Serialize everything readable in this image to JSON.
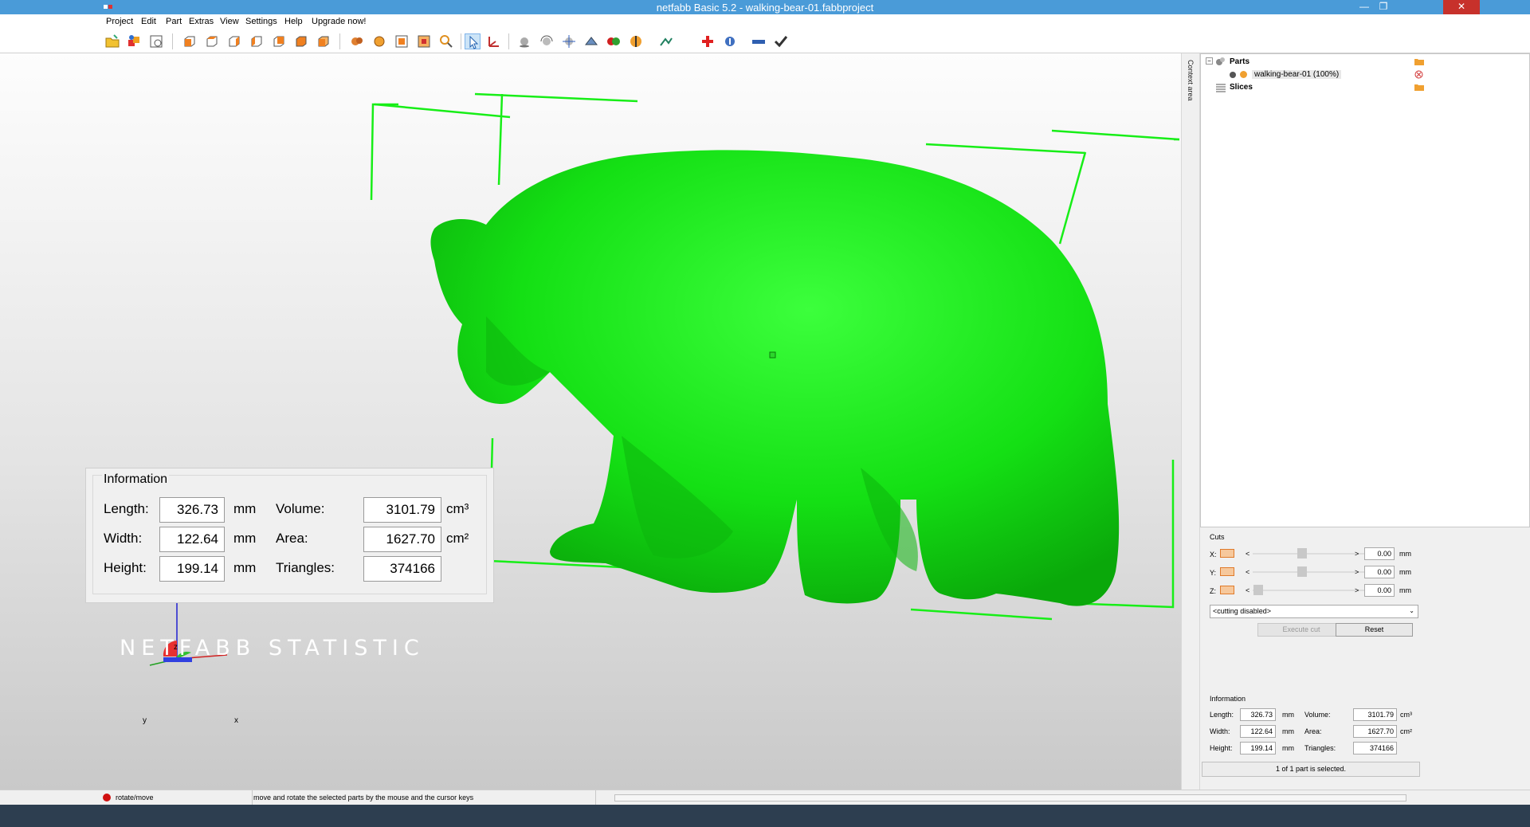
{
  "window": {
    "title": "netfabb Basic 5.2 - walking-bear-01.fabbproject"
  },
  "menu": [
    "Project",
    "Edit",
    "Part",
    "Extras",
    "View",
    "Settings",
    "Help",
    "Upgrade now!"
  ],
  "colors": {
    "titlebar": "#4a9bd8",
    "model": "#1ee81e",
    "bbox": "#17ee17",
    "close": "#c7312b",
    "taskbar": "#2d3e50"
  },
  "toolbar_icons": [
    "open-project-icon",
    "add-part-icon",
    "save-icon",
    "view-front-icon",
    "view-back-icon",
    "view-left-icon",
    "view-right-icon",
    "view-top-icon",
    "view-bottom-icon",
    "view-perspective-icon",
    "shading-icon",
    "mesh-icon",
    "zoom-all-icon",
    "zoom-selection-icon",
    "zoom-icon",
    "select-arrow-icon",
    "move-axes-icon",
    "sphere-icon",
    "rotate-icon",
    "scale-icon",
    "mirror-icon",
    "color-icon",
    "section-icon",
    "measure-icon",
    "repair-cross-icon",
    "analysis-icon",
    "ruler-icon",
    "check-icon"
  ],
  "viewport": {
    "info": {
      "title": "Information",
      "length_label": "Length:",
      "length": "326.73",
      "length_unit": "mm",
      "width_label": "Width:",
      "width": "122.64",
      "width_unit": "mm",
      "height_label": "Height:",
      "height": "199.14",
      "height_unit": "mm",
      "volume_label": "Volume:",
      "volume": "3101.79",
      "volume_unit": "cm³",
      "area_label": "Area:",
      "area": "1627.70",
      "area_unit": "cm²",
      "triangles_label": "Triangles:",
      "triangles": "374166"
    },
    "watermark": "NETFABB STATISTIC",
    "axes": {
      "x": "x",
      "y": "y",
      "z": "z"
    }
  },
  "side_tab": "Context area",
  "tree": {
    "parts_label": "Parts",
    "part_name": "walking-bear-01 (100%)",
    "slices_label": "Slices"
  },
  "cuts": {
    "title": "Cuts",
    "x_label": "X:",
    "y_label": "Y:",
    "z_label": "Z:",
    "lt": "<",
    "gt": ">",
    "x_value": "0.00",
    "y_value": "0.00",
    "z_value": "0.00",
    "unit": "mm",
    "mode": "<cutting disabled>",
    "execute_label": "Execute cut",
    "reset_label": "Reset"
  },
  "panel_info": {
    "title": "Information",
    "length_label": "Length:",
    "length": "326.73",
    "width_label": "Width:",
    "width": "122.64",
    "height_label": "Height:",
    "height": "199.14",
    "volume_label": "Volume:",
    "volume": "3101.79",
    "area_label": "Area:",
    "area": "1627.70",
    "triangles_label": "Triangles:",
    "triangles": "374166",
    "mm": "mm",
    "cm3": "cm³",
    "cm2": "cm²",
    "selection_status": "1 of 1 part is selected."
  },
  "status": {
    "mode": "rotate/move",
    "hint": "move and rotate the selected parts by the mouse and the cursor keys"
  }
}
